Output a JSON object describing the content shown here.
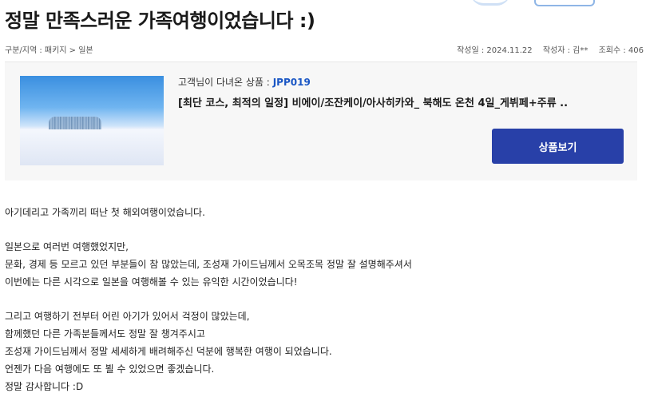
{
  "post": {
    "title": "정말 만족스러운 가족여행이었습니다 :)",
    "breadcrumb": "구분/지역 : 패키지 > 일본",
    "date": "작성일 : 2024.11.22",
    "author": "작성자 : 김**",
    "views": "조회수 : 406"
  },
  "product": {
    "label_prefix": "고객님이 다녀온 상품 :",
    "code": "JPP019",
    "name": "[최단 코스, 최적의 일정] 비에이/조잔케이/아사히카와_ 북해도 온천 4일_게뷔페+주류 ..",
    "button_label": "상품보기",
    "thumbnail_icon": "snowy-landscape-photo",
    "button_color": "#2840a8",
    "code_color": "#1a56c4"
  },
  "content": {
    "paragraphs": [
      [
        "아기데리고 가족끼리 떠난 첫 해외여행이었습니다."
      ],
      [
        "일본으로 여러번 여행했었지만,",
        "문화, 경제 등 모르고 있던 부분들이 참 많았는데, 조성재 가이드님께서 오목조목 정말 잘 설명해주셔서",
        "이번에는 다른 시각으로 일본을 여행해볼 수 있는 유익한 시간이었습니다!"
      ],
      [
        "그리고 여행하기 전부터 어린 아기가 있어서 걱정이 많았는데,",
        "함께했던 다른 가족분들께서도 정말 잘 챙겨주시고",
        "조성재 가이드님께서 정말 세세하게 배려해주신 덕분에 행복한 여행이 되었습니다.",
        "언젠가 다음 여행에도 또 뵐 수 있었으면 좋겠습니다.",
        "정말 감사합니다 :D"
      ]
    ]
  }
}
